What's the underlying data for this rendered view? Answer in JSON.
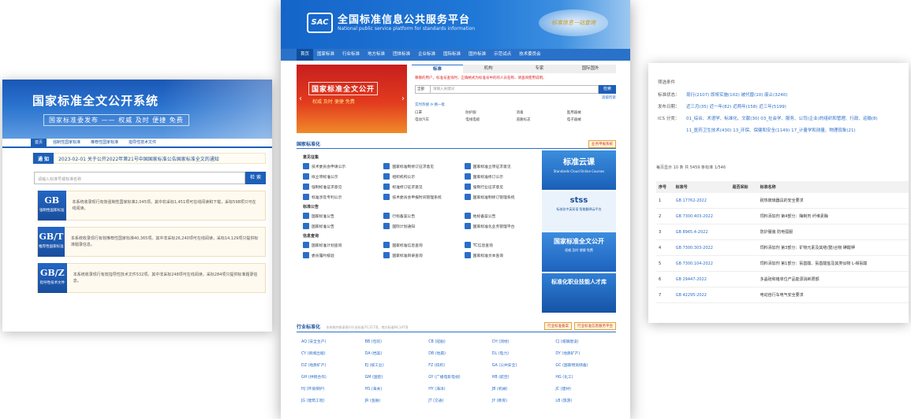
{
  "left": {
    "title": "国家标准全文公开系统",
    "slogan": "国家标准委发布 —— 权威 及时 便捷 免费",
    "nav": [
      "首页",
      "强制性国家标准",
      "推荐性国家标准",
      "指导性技术文件"
    ],
    "notice_tag": "通 知",
    "notice_text": "2023-02-01 关于公开2022年第21号中国国家标准公告国家标准全文的通知",
    "search_placeholder": "请输入标准号或标准名称",
    "search_button": "检 索",
    "cards": [
      {
        "code": "GB",
        "sub": "强制性国家标准",
        "desc": "本系统收录现行有效强制性国家标准2,045项。其中非采标1,451项可在线阅读和下载，采标598项只可在线阅读。"
      },
      {
        "code": "GB/T",
        "sub": "推荐性国家标准",
        "desc": "本系统收录现行有效推荐性国家标准40,365项。其中非采标26,240项可在线阅读，采标14,129项只提供标准题录信息。"
      },
      {
        "code": "GB/Z",
        "sub": "指导性技术文件",
        "desc": "本系统收录现行有效指导性技术文件532项。其中非采标248项可在线阅读，采标284项只提供标准题录信息。"
      }
    ]
  },
  "center": {
    "logo": "SAC",
    "title": "全国标准信息公共服务平台",
    "subtitle": "National public service platform for standards information",
    "motto": "标准信息一站查询",
    "nav": [
      "首页",
      "国家标准",
      "行业标准",
      "地方标准",
      "团体标准",
      "企业标准",
      "国际标准",
      "国外标准",
      "示范试点",
      "技术委员会"
    ],
    "banner_title": "国家标准全文公开",
    "banner_slogan": "权威 及时 便捷 免费",
    "search_tabs": [
      "标准",
      "机构",
      "专家",
      "国际国外"
    ],
    "warning": "尊敬的用户，标准号查询时，正确格式为标准号中的的人员名称，请查阅使用说明。",
    "scope": "全部",
    "search_placeholder": "请输入关键词",
    "search_button": "检索",
    "advanced": "高级检索",
    "hot_label": "实时热搜",
    "hot_change": "换一批",
    "hot_terms": [
      "口罩",
      "防护服",
      "消毒",
      "医用器械",
      "电动汽车",
      "电线电缆",
      "道路标志",
      "电子器械"
    ],
    "section_national": "国家标准化",
    "national_button": "业务申报系统",
    "groups": [
      {
        "name": "意见征集",
        "items": [
          "技术委员会申请公示",
          "国家标准制修订征求意见",
          "国家标准立项征求意见",
          "拟立项标准公示",
          "组织机构公示",
          "国家标准修订公示",
          "强制标准征求意见",
          "标准修订征求意见",
          "强制行业征求意见",
          "标准涉及专利公示",
          "技术委员会申报时间管理系统",
          "国家标准制修订管理系统"
        ]
      },
      {
        "name": "标准公告",
        "items": [
          "国家标准公告",
          "行标备案公告",
          "地标备案公告",
          "国家标准公告",
          "国际计划通知",
          "国家标准化业务管理平台"
        ]
      },
      {
        "name": "信息查询",
        "items": [
          "国家标准计划查询",
          "国家标准信息查询",
          "TC信息查询",
          "委员履约核验",
          "国家标准目录查询",
          "国家标准文本查询"
        ]
      }
    ],
    "ads": [
      {
        "big": "标准云课",
        "sm": "Standards Cloud Online Courses"
      },
      {
        "big": "stss",
        "sm": "标准化中英双语 智能翻译云平台"
      },
      {
        "big": "国家标准全文公开",
        "sm": "权威 及时 便捷 免费"
      },
      {
        "big": "标准化职业技能人才库",
        "sm": ""
      }
    ],
    "section_industry": "行业标准化",
    "industry_note": "本系统共收录现行行业标准70,117项，地方标准64,147项",
    "industry_buttons": [
      "行业标准备案",
      "行业标准信息服务平台"
    ],
    "industry_codes": [
      "AQ (安全生产)",
      "BB (包装)",
      "CB (船舶)",
      "CH (测绘)",
      "CJ (城镇建设)",
      "CY (新闻出版)",
      "DA (档案)",
      "DB (地震)",
      "DL (电力)",
      "DY (地质矿产)",
      "DZ (地质矿产)",
      "EJ (核工业)",
      "FZ (纺织)",
      "GA (公共安全)",
      "GC (国家物资储备)",
      "GH (供销合作)",
      "GM (国密)",
      "GY (广播电影电视)",
      "HB (航空)",
      "HG (化工)",
      "HJ (环境保护)",
      "HS (海关)",
      "HY (海洋)",
      "JB (机械)",
      "JC (建材)",
      "JG (建筑工程)",
      "JR (金融)",
      "JT (交通)",
      "JY (教育)",
      "LB (旅游)"
    ]
  },
  "right": {
    "filter_header": "筛选条件",
    "filters": [
      {
        "k": "标准状态：",
        "v": "现行(2107)  即将实施(102)  被代替(10)  废止(3240)"
      },
      {
        "k": "发布日期：",
        "v": "近三月(35)  近一年(82)  近两年(158)  近三年(5199)"
      },
      {
        "k": "ICS 分类：",
        "v": "01_综合、术语学、标准化、文献(30)  03_社会学、服务、公司(企业)的组织和管理、行政、运输(8)"
      },
      {
        "k": "",
        "v": "11_医药卫生技术(430)  13_环保、保健和安全(1149)  17_计量学和测量、物理现象(21)"
      }
    ],
    "pager": "每页显示 10 条 共 5459 条标准 1/546",
    "table_headers": [
      "序号",
      "标准号",
      "是否采标",
      "标准名称"
    ],
    "rows": [
      {
        "n": "1",
        "no": "GB 17762-2022",
        "name": "耐热玻璃器具的安全要求"
      },
      {
        "n": "2",
        "no": "GB 7300.403-2022",
        "name": "饲料添加剂 第4部分：酶制剂 纤维素酶"
      },
      {
        "n": "3",
        "no": "GB 8965.4-2022",
        "name": "防护服装 防电弧服"
      },
      {
        "n": "4",
        "no": "GB 7300.303-2022",
        "name": "饲料添加剂 第3部分：矿物元素及其络(螯)合物 碘酸钾"
      },
      {
        "n": "5",
        "no": "GB 7300.104-2022",
        "name": "饲料添加剂 第1部分：氨基酸、氨基酸盐及其类似物 L-缬氨酸"
      },
      {
        "n": "6",
        "no": "GB 29447-2022",
        "name": "多晶硅和锗单位产品能源消耗限额"
      },
      {
        "n": "7",
        "no": "GB 42295-2022",
        "name": "电动自行车电气安全要求"
      }
    ]
  },
  "colors": {
    "primary": "#1d5fb8",
    "banner_red": "#d8281e",
    "link": "#2b6ec8"
  }
}
